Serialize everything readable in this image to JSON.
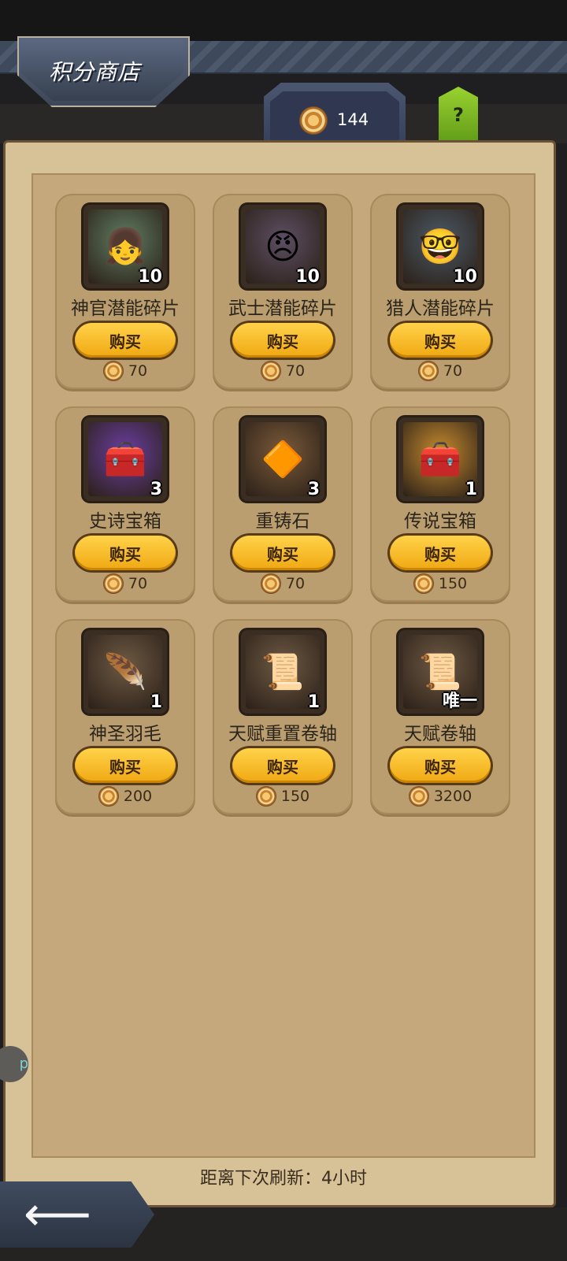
{
  "header": {
    "title": "积分商店",
    "points": "144",
    "help": "?"
  },
  "items": [
    {
      "name": "神官潜能碎片",
      "qty": "10",
      "buy": "购买",
      "price": "70",
      "icon": "priest-portrait-icon",
      "bg": "#5f7d62",
      "glyph": "👧"
    },
    {
      "name": "武士潜能碎片",
      "qty": "10",
      "buy": "购买",
      "price": "70",
      "icon": "samurai-portrait-icon",
      "bg": "#5d4f63",
      "glyph": "😠"
    },
    {
      "name": "猎人潜能碎片",
      "qty": "10",
      "buy": "购买",
      "price": "70",
      "icon": "hunter-portrait-icon",
      "bg": "#4b5a66",
      "glyph": "🤓"
    },
    {
      "name": "史诗宝箱",
      "qty": "3",
      "buy": "购买",
      "price": "70",
      "icon": "epic-chest-icon",
      "bg": "#6a3ea0",
      "glyph": "🧰"
    },
    {
      "name": "重铸石",
      "qty": "3",
      "buy": "购买",
      "price": "70",
      "icon": "reforge-stone-icon",
      "bg": "#7a5a3a",
      "glyph": "🔶"
    },
    {
      "name": "传说宝箱",
      "qty": "1",
      "buy": "购买",
      "price": "150",
      "icon": "legendary-chest-icon",
      "bg": "#c58a2e",
      "glyph": "🧰"
    },
    {
      "name": "神圣羽毛",
      "qty": "1",
      "buy": "购买",
      "price": "200",
      "icon": "holy-feather-icon",
      "bg": "#6e5a44",
      "glyph": "🪶"
    },
    {
      "name": "天赋重置卷轴",
      "qty": "1",
      "buy": "购买",
      "price": "150",
      "icon": "talent-reset-scroll-icon",
      "bg": "#6e5a44",
      "glyph": "📜"
    },
    {
      "name": "天赋卷轴",
      "qty": "唯一",
      "buy": "购买",
      "price": "3200",
      "icon": "talent-scroll-icon",
      "bg": "#6e5a44",
      "glyph": "📜"
    }
  ],
  "footer": {
    "refresh": "距离下次刷新：4小时",
    "side_bubble": "p"
  }
}
